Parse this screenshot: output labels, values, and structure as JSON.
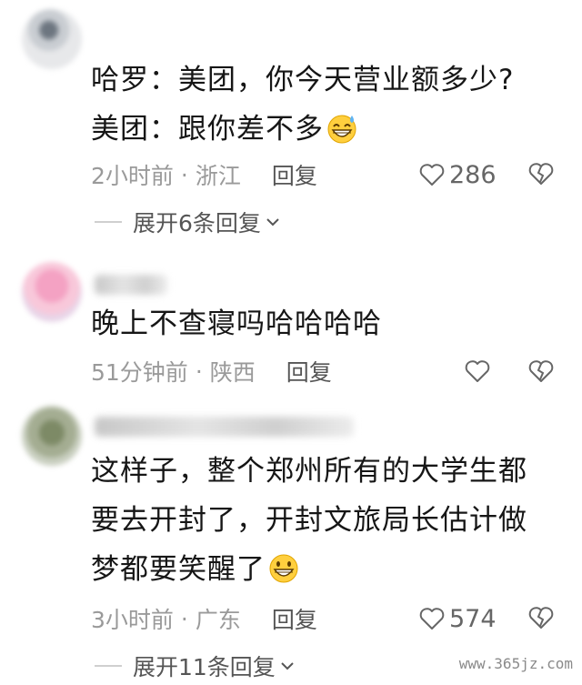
{
  "comments": [
    {
      "lines": [
        "哈罗：美团，你今天营业额多少?",
        "美团：跟你差不多"
      ],
      "emoji": "grinning-sweat-emoji",
      "time": "2小时前",
      "location": "浙江",
      "reply_label": "回复",
      "likes": "286",
      "expand_label": "展开6条回复"
    },
    {
      "lines": [
        "晚上不查寝吗哈哈哈哈"
      ],
      "time": "51分钟前",
      "location": "陕西",
      "reply_label": "回复",
      "likes": ""
    },
    {
      "lines": [
        "这样子，整个郑州所有的大学生都",
        "要去开封了，开封文旅局长估计做",
        "梦都要笑醒了"
      ],
      "emoji": "grinning-emoji",
      "time": "3小时前",
      "location": "广东",
      "reply_label": "回复",
      "likes": "574",
      "expand_label": "展开11条回复"
    }
  ],
  "separator": "·",
  "watermark": "www.365jz.com",
  "colors": {
    "text": "#161616",
    "meta": "#9a9a9a",
    "action": "#555555"
  }
}
